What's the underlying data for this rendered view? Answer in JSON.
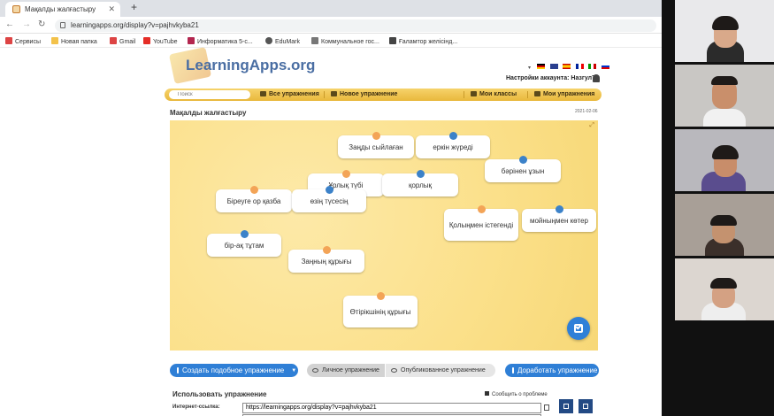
{
  "browser": {
    "tab_title": "Мақалды жалғастыру",
    "close_glyph": "✕",
    "new_tab_glyph": "+",
    "url": "learningapps.org/display?v=pajhvkyba21",
    "bookmarks": [
      {
        "label": "Сервисы",
        "color": "#d44"
      },
      {
        "label": "Новая папка",
        "color": "#f3c24a"
      },
      {
        "label": "Gmail",
        "color": "#d44"
      },
      {
        "label": "YouTube",
        "color": "#e52d27"
      },
      {
        "label": "Информатика 5-с...",
        "color": "#b3264f"
      },
      {
        "label": "EduMark",
        "color": "#555"
      },
      {
        "label": "Коммунальное гос...",
        "color": "#777"
      },
      {
        "label": "Ғаламтор желісінд...",
        "color": "#444"
      }
    ]
  },
  "site": {
    "logo": "LearningApps.org",
    "account": "Настройки аккаунта: Назгул77",
    "search_placeholder": "Поиск",
    "menu": {
      "all": "Все упражнения",
      "new": "Новое упражнение",
      "classes": "Мои классы",
      "mine": "Мои упражнения"
    },
    "exercise_title": "Мақалды жалғастыру",
    "date": "2021-02-06",
    "cards": [
      {
        "text": "Заңды сыйлаған",
        "dot": "orange"
      },
      {
        "text": "еркін жүреді",
        "dot": "blue"
      },
      {
        "text": "бәрінен ұзын",
        "dot": "blue"
      },
      {
        "text": "Ұрлық түбі",
        "dot": "orange"
      },
      {
        "text": "қорлық",
        "dot": "blue"
      },
      {
        "text": "Біреуге ор қазба",
        "dot": "orange"
      },
      {
        "text": "өзің түсесің",
        "dot": "blue"
      },
      {
        "text": "Қолыңмен істегенді",
        "dot": "orange"
      },
      {
        "text": "мойныңмен көтер",
        "dot": "blue"
      },
      {
        "text": "бір-ақ тұтам",
        "dot": "blue"
      },
      {
        "text": "Заңның құрығы",
        "dot": "orange"
      },
      {
        "text": "Өтірікшінің құрығы",
        "dot": "orange"
      }
    ],
    "buttons": {
      "create_similar": "Создать подобное упражнение",
      "private": "Личное упражнение",
      "published": "Опубликованное упражнение",
      "improve": "Доработать упражнение"
    },
    "use_title": "Использовать упражнение",
    "report": "Сообщить о проблеме",
    "link_label": "Интернет-ссылка:",
    "link_value": "https://learningapps.org/display?v=pajhvkyba21"
  },
  "colors": {
    "accent_blue": "#2f7fd6",
    "board_yellow": "#fbe493",
    "dot_orange": "#f3a457",
    "dot_blue": "#3c82c9"
  }
}
